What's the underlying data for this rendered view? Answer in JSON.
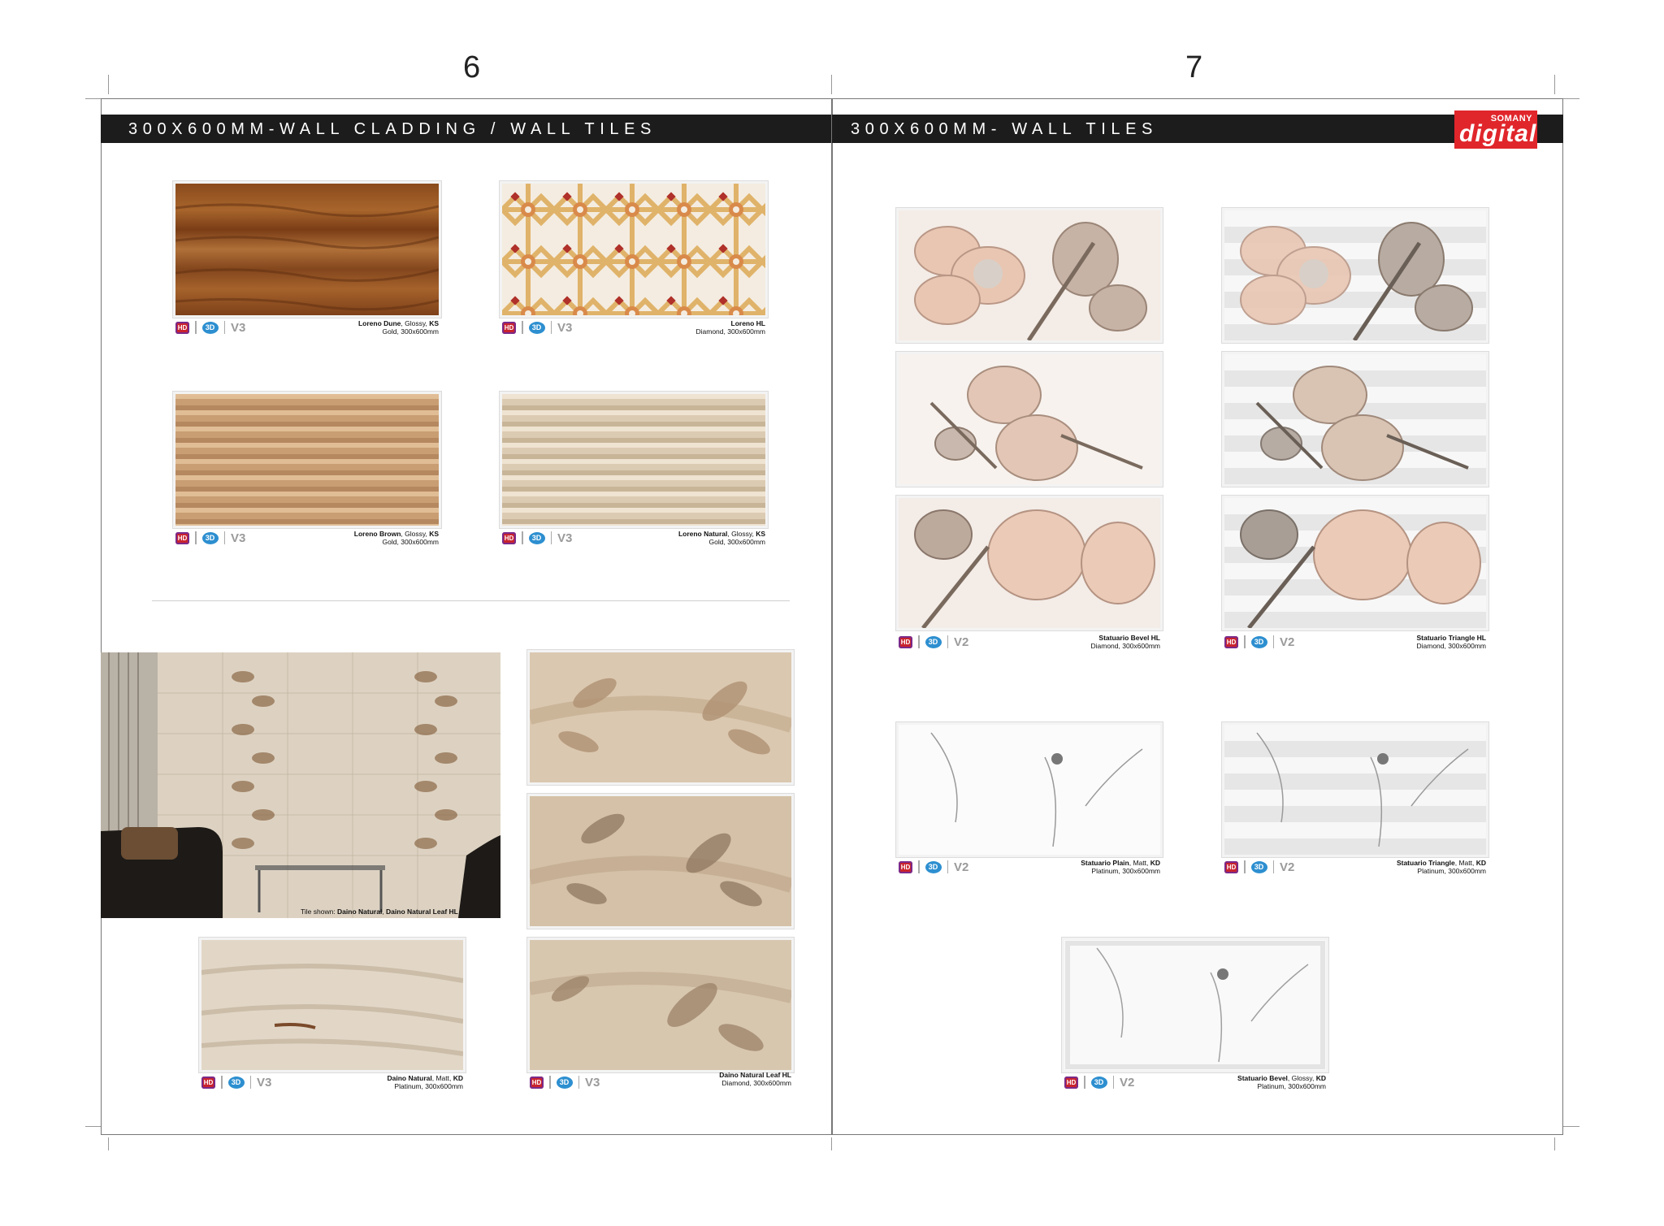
{
  "pages": {
    "left": "6",
    "right": "7"
  },
  "left_header": "300X600MM-WALL CLADDING / WALL TILES",
  "right_header": "300X600MM- WALL TILES",
  "logo": {
    "brand": "SOMANY",
    "sub": "digital",
    "color": "#e0262b"
  },
  "badge_labels": {
    "hd": "HD",
    "three_d": "3D"
  },
  "tiles": [
    {
      "name": "Loreno Dune",
      "finish": ", Glossy, ",
      "code": "KS",
      "line2": "Gold, 300x600mm",
      "version": "V3"
    },
    {
      "name": "Loreno HL",
      "finish": "",
      "code": "",
      "line2": "Diamond, 300x600mm",
      "version": "V3"
    },
    {
      "name": "Loreno Brown",
      "finish": ", Glossy, ",
      "code": "KS",
      "line2": "Gold, 300x600mm",
      "version": "V3"
    },
    {
      "name": "Loreno Natural",
      "finish": ", Glossy, ",
      "code": "KS",
      "line2": "Gold, 300x600mm",
      "version": "V3"
    },
    {
      "name": "Daino Natural",
      "finish": ", Matt, ",
      "code": "KD",
      "line2": "Platinum, 300x600mm",
      "version": "V3"
    },
    {
      "name": "Daino Natural Leaf HL",
      "finish": "",
      "code": "",
      "line2": "Diamond, 300x600mm",
      "version": "V3"
    },
    {
      "name": "Statuario Bevel HL",
      "finish": "",
      "code": "",
      "line2": "Diamond, 300x600mm",
      "version": "V2"
    },
    {
      "name": "Statuario Triangle HL",
      "finish": "",
      "code": "",
      "line2": "Diamond, 300x600mm",
      "version": "V2"
    },
    {
      "name": "Statuario Plain",
      "finish": ", Matt, ",
      "code": "KD",
      "line2": "Platinum, 300x600mm",
      "version": "V2"
    },
    {
      "name": "Statuario Triangle",
      "finish": ", Matt, ",
      "code": "KD",
      "line2": "Platinum, 300x600mm",
      "version": "V2"
    },
    {
      "name": "Statuario Bevel",
      "finish": ", Glossy, ",
      "code": "KD",
      "line2": "Platinum, 300x600mm",
      "version": "V2"
    }
  ],
  "room_caption": {
    "prefix": "Tile shown: ",
    "a": "Daino Natural",
    "sep": ", ",
    "b": "Daino Natural Leaf HL"
  },
  "colors": {
    "header_bar": "#1c1c1c",
    "hd_badge": "#c9232d",
    "three_d_badge": "#2d8fd0"
  }
}
